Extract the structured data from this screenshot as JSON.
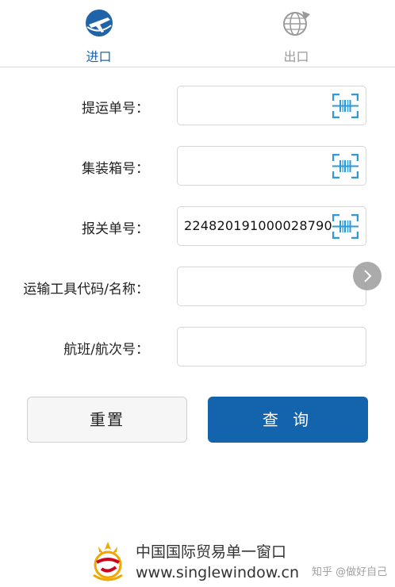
{
  "tabs": [
    {
      "label": "进口",
      "icon": "plane-globe-icon",
      "active": true
    },
    {
      "label": "出口",
      "icon": "globe-arrow-icon",
      "active": false
    }
  ],
  "form": {
    "fields": [
      {
        "label": "提运单号：",
        "value": "",
        "scan_icon": "barcode-scan-icon"
      },
      {
        "label": "集装箱号：",
        "value": "",
        "scan_icon": "barcode-scan-icon"
      },
      {
        "label": "报关单号：",
        "value": "224820191000028790",
        "scan_icon": "barcode-scan-icon"
      },
      {
        "label": "运输工具代码/名称：",
        "value": ""
      },
      {
        "label": "航班/航次号：",
        "value": ""
      }
    ]
  },
  "buttons": {
    "reset": "重置",
    "query": "查 询"
  },
  "footer": {
    "name": "中国国际贸易单一窗口",
    "url": "www.singlewindow.cn",
    "watermark": "知乎 @做好自己"
  },
  "colors": {
    "accent": "#1464ad",
    "active_tab": "#1f63a8",
    "inactive_tab": "#9a9a9a",
    "scan_icon": "#2e9ad6"
  }
}
